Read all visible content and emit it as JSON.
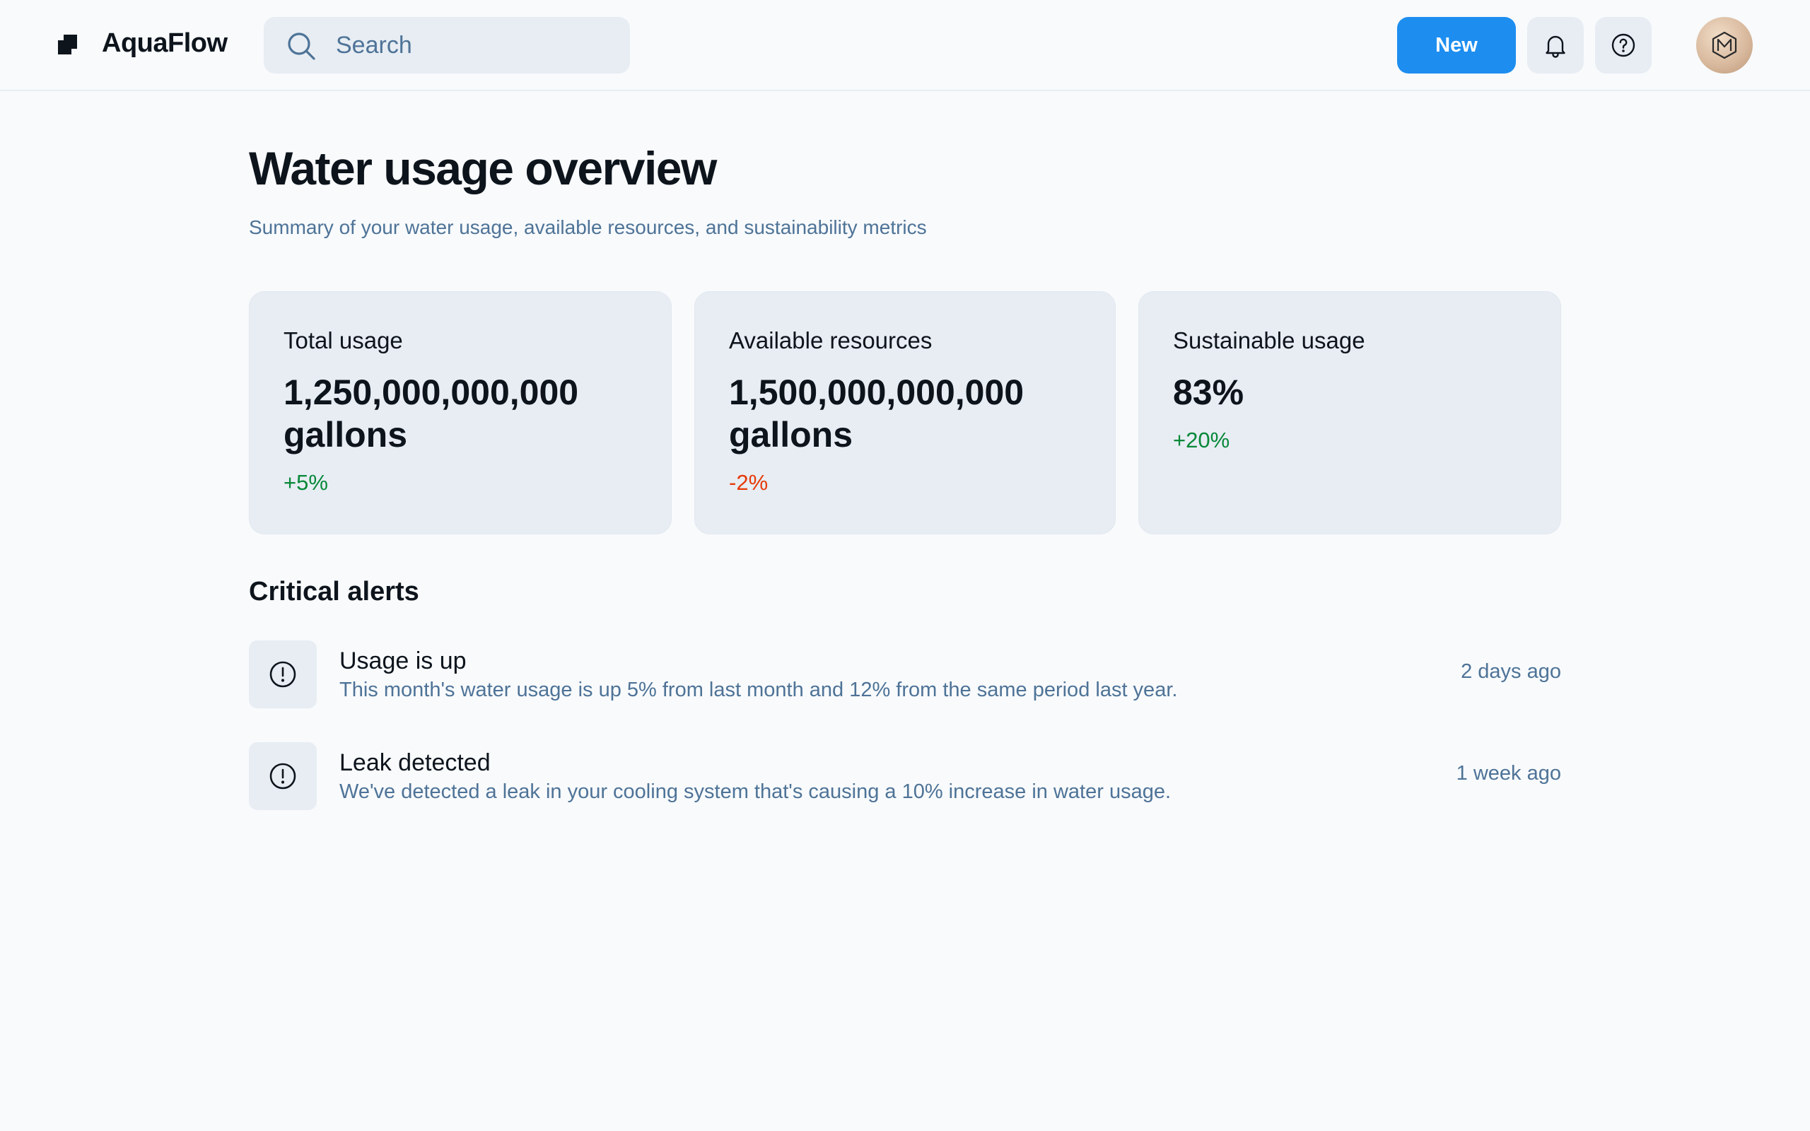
{
  "header": {
    "brand": "AquaFlow",
    "search_placeholder": "Search",
    "new_button": "New",
    "icons": [
      "logo-icon",
      "search-icon",
      "bell-icon",
      "help-icon",
      "avatar"
    ]
  },
  "main": {
    "title": "Water usage overview",
    "subtitle": "Summary of your water usage, available resources, and sustainability metrics",
    "cards": [
      {
        "label": "Total usage",
        "value": "1,250,000,000,000 gallons",
        "change": "+5%",
        "trend": "positive"
      },
      {
        "label": "Available resources",
        "value": "1,500,000,000,000 gallons",
        "change": "-2%",
        "trend": "negative"
      },
      {
        "label": "Sustainable usage",
        "value": "83%",
        "change": "+20%",
        "trend": "positive"
      }
    ],
    "alerts_title": "Critical alerts",
    "alerts": [
      {
        "title": "Usage is up",
        "description": "This month's water usage is up 5% from last month and 12% from the same period last year.",
        "time": "2 days ago"
      },
      {
        "title": "Leak detected",
        "description": "We've detected a leak in your cooling system that's causing a 10% increase in water usage.",
        "time": "1 week ago"
      }
    ]
  },
  "colors": {
    "accent": "#1d8ef0",
    "positive": "#078838",
    "negative": "#e73908",
    "muted_text": "#4e7397",
    "card_bg": "#e7edf3"
  }
}
